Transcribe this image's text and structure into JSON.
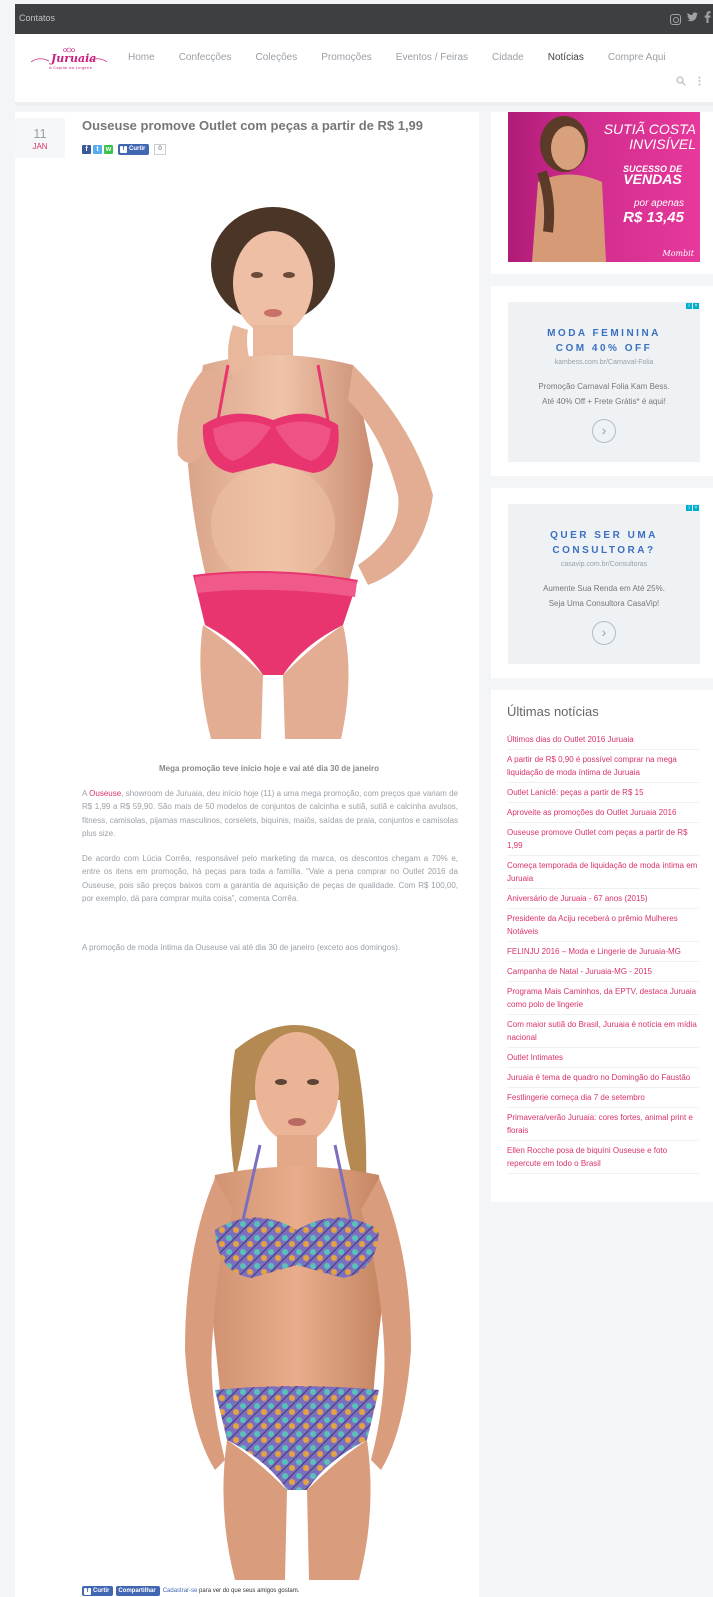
{
  "topbar": {
    "contacts": "Contatos",
    "social_icons": [
      "instagram-icon",
      "twitter-icon",
      "facebook-icon"
    ]
  },
  "header": {
    "logo": {
      "title": "Juruaia",
      "subtitle": "A Capital da Lingerie"
    },
    "nav": [
      {
        "label": "Home"
      },
      {
        "label": "Confecções"
      },
      {
        "label": "Coleções"
      },
      {
        "label": "Promoções"
      },
      {
        "label": "Eventos / Feiras"
      },
      {
        "label": "Cidade"
      },
      {
        "label": "Notícias",
        "active": true
      },
      {
        "label": "Compre Aqui"
      }
    ],
    "icons": [
      "search-icon",
      "more-icon"
    ]
  },
  "post": {
    "day": "11",
    "month": "JAN",
    "title": "Ouseuse promove Outlet com peças a partir de R$ 1,99",
    "like_label": "Curtir",
    "like_count": "0",
    "caption": "Mega promoção teve início hoje e vai até dia 30 de janeiro",
    "p1_link": "Ouseuse",
    "p1_rest": ", showroom de Juruaia, deu início hoje (11) a uma mega promoção, com preços que variam de R$ 1,99 a R$ 59,90. São mais de 50 modelos de conjuntos de calcinha e sutiã, sutiã e calcinha avulsos, fitness, camisolas, pijamas masculinos, corselets, biquínis, maiôs, saídas de praia, conjuntos e camisolas plus size.",
    "p1_prefix": "A ",
    "p2": "De acordo com Lúcia Corrêa, responsável pelo marketing da marca, os descontos chegam a 70% e, entre os itens em promoção, há peças para toda a família. “Vale a pena comprar no Outlet 2016 da Ouseuse, pois são preços baixos com a garantia de aquisição de peças de qualidade. Com R$ 100,00, por exemplo, dá para comprar muita coisa”, comenta Corrêa.",
    "p3": "A promoção de moda íntima da Ouseuse vai até dia 30 de janeiro (exceto aos domingos).",
    "fb_like": "Curtir",
    "fb_share": "Compartilhar",
    "fb_signup": "Cadastrar-se",
    "fb_text": " para ver do que seus amigos gostam."
  },
  "sidebar": {
    "banner": {
      "line1": "SUTIÃ COSTA",
      "line2": "INVISÍVEL",
      "line3": "SUCESSO DE",
      "line4": "VENDAS",
      "line5": "por apenas",
      "price": "R$ 13,45",
      "brand": "Mombit"
    },
    "ad1": {
      "heading1": "MODA FEMININA",
      "heading2": "COM 40% OFF",
      "url": "kambess.com.br/Carnaval-Folia",
      "desc1": "Promoção Carnaval Folia Kam Bess.",
      "desc2": "Até 40% Off + Frete Grátis* é aqui!"
    },
    "ad2": {
      "heading1": "QUER SER UMA",
      "heading2": "CONSULTORA?",
      "url": "casavip.com.br/Consultoras",
      "desc1": "Aumente Sua Renda em Até 25%.",
      "desc2": "Seja Uma Consultora CasaVip!"
    },
    "news_title": "Últimas notícias",
    "news": [
      "Últimos dias do Outlet 2016 Juruaia",
      "A partir de R$ 0,90 é possível comprar na mega liquidação de moda íntima de Juruaia",
      "Outlet Laniclê: peças a partir de R$ 15",
      "Aproveite as promoções do Outlet Juruaia 2016",
      "Ouseuse promove Outlet com peças a partir de R$ 1,99",
      "Começa temporada de liquidação de moda íntima em Juruaia",
      "Aniversário de Juruaia - 67 anos (2015)",
      "Presidente da Aciju receberá o prêmio Mulheres Notáveis",
      "FELINJU 2016 – Moda e Lingerie de Juruaia-MG",
      "Campanha de Natal - Juruaia-MG - 2015",
      "Programa Mais Caminhos, da EPTV, destaca Juruaia como polo de lingerie",
      "Com maior sutiã do Brasil, Juruaia é notícia em mídia nacional",
      "Outlet Intimates",
      "Juruaia é tema de quadro no Domingão do Faustão",
      "Festlingerie começa dia 7 de setembro",
      "Primavera/verão Juruaia: cores fortes, animal print e florais",
      "Ellen Rocche posa de biquíni Ouseuse e foto repercute em todo o Brasil"
    ]
  },
  "colors": {
    "accent": "#d9336a",
    "topbar": "#3d3f41",
    "banner": "#d02d8e",
    "ad_heading": "#3b6fbf"
  }
}
